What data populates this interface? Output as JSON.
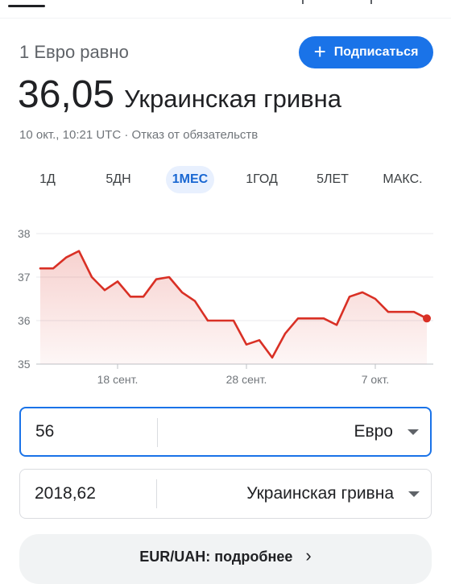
{
  "header": {
    "rate_label": "1 Евро равно",
    "subscribe_label": "Подписаться",
    "rate_value": "36,05",
    "rate_currency": "Украинская гривна",
    "meta": "10 окт., 10:21 UTC · Отказ от обязательств"
  },
  "ranges": [
    {
      "label": "1Д",
      "active": false
    },
    {
      "label": "5ДН",
      "active": false
    },
    {
      "label": "1МЕС",
      "active": true
    },
    {
      "label": "1ГОД",
      "active": false
    },
    {
      "label": "5ЛЕТ",
      "active": false
    },
    {
      "label": "МАКС.",
      "active": false
    }
  ],
  "colors": {
    "line": "#d93025",
    "accent": "#1a73e8",
    "active_tab_bg": "#e8f0fe",
    "active_tab_text": "#1967d2"
  },
  "chart_data": {
    "type": "area",
    "title": "",
    "xlabel": "",
    "ylabel": "",
    "ylim": [
      35,
      38
    ],
    "yticks": [
      "38",
      "37",
      "36",
      "35"
    ],
    "xtick_labels": [
      "18 сент.",
      "28 сент.",
      "7 окт."
    ],
    "grid": true,
    "series": [
      {
        "values": [
          37.2,
          37.2,
          37.45,
          37.6,
          37.0,
          36.7,
          36.9,
          36.55,
          36.55,
          36.95,
          37.0,
          36.65,
          36.45,
          36.0,
          36.0,
          36.0,
          35.45,
          35.55,
          35.15,
          35.7,
          36.05,
          36.05,
          36.05,
          35.9,
          36.55,
          36.65,
          36.5,
          36.2,
          36.2,
          36.2,
          36.05
        ]
      }
    ]
  },
  "converter": {
    "amount_value": "56",
    "amount_currency": "Евро",
    "result_value": "2018,62",
    "result_currency": "Украинская гривна"
  },
  "more_label": "EUR/UAH: подробнее"
}
